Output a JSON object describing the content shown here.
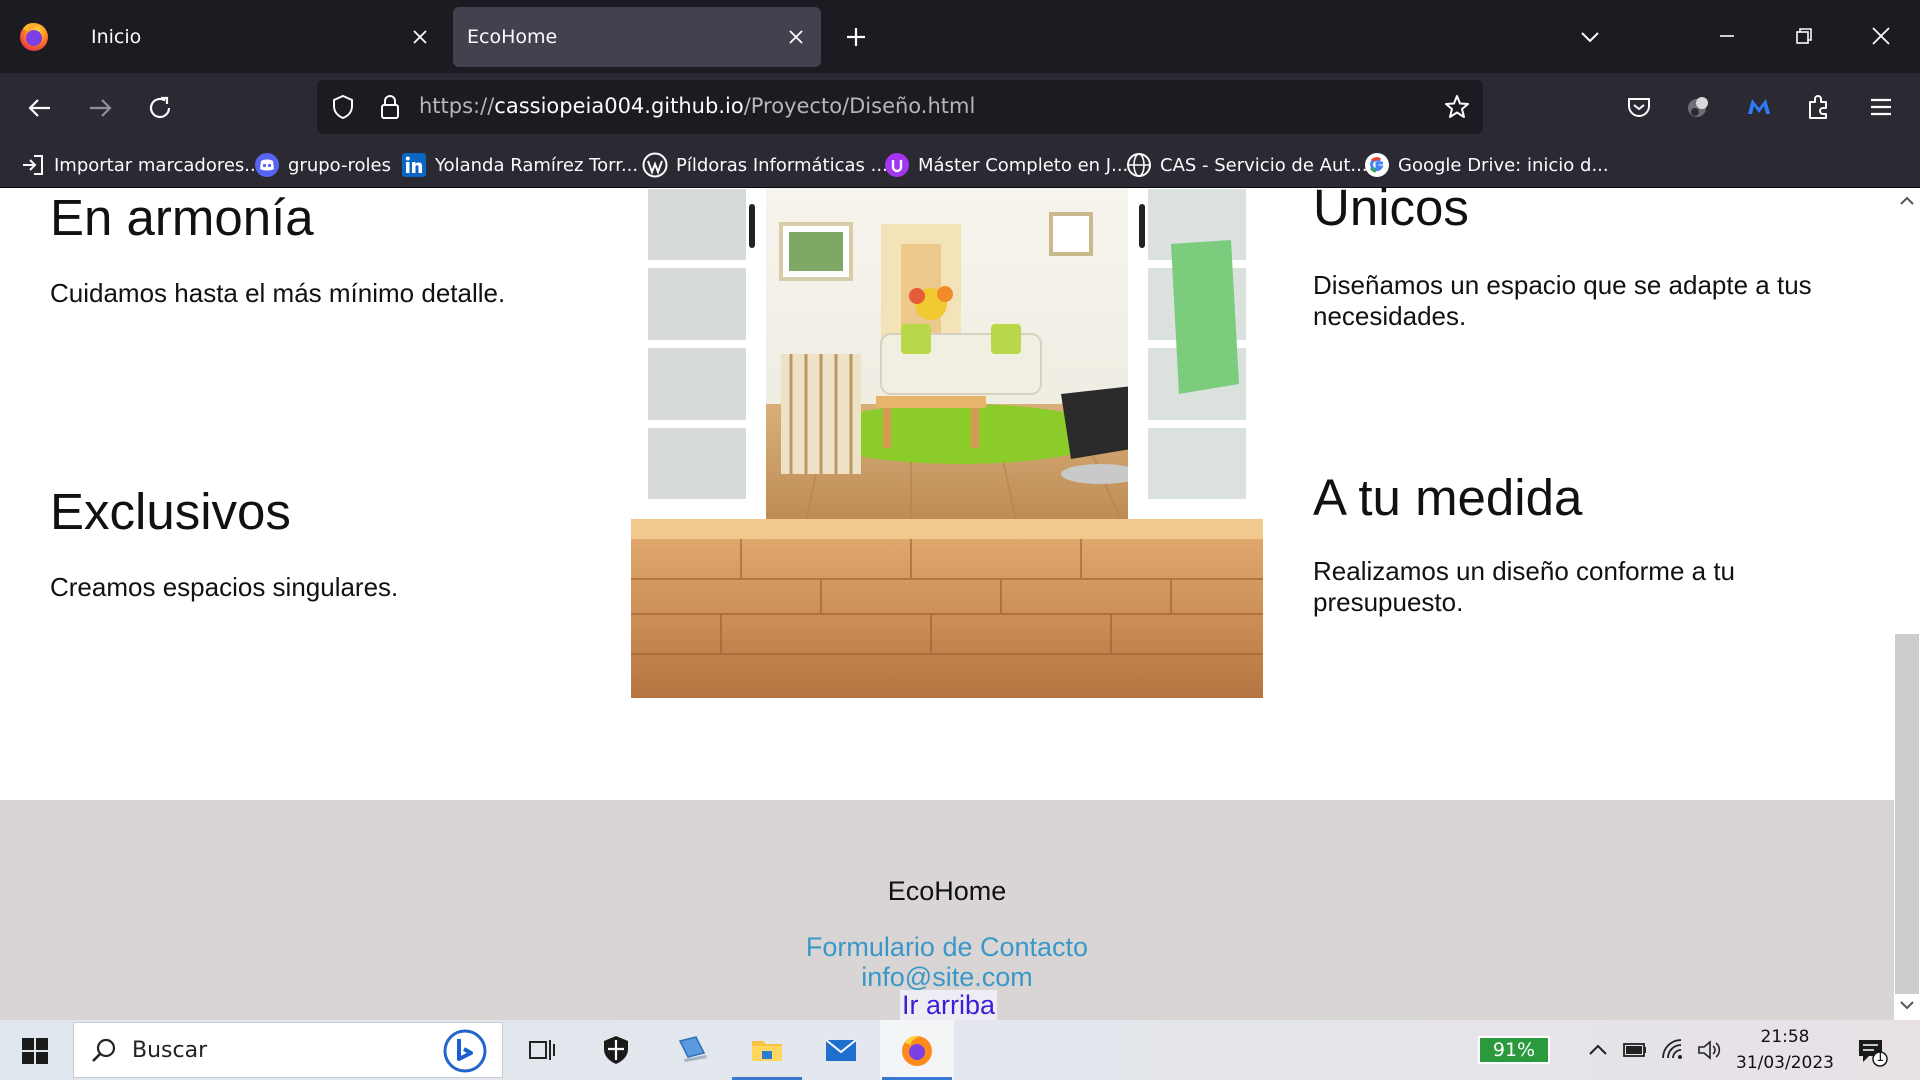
{
  "browser": {
    "tabs": [
      {
        "label": "Inicio",
        "active": false
      },
      {
        "label": "EcoHome",
        "active": true
      }
    ],
    "url": {
      "scheme": "https://",
      "host": "cassiopeia004.github.io",
      "path": "/Proyecto/Diseño.html"
    },
    "bookmarks": [
      {
        "label": "Importar marcadores...",
        "icon": "import-icon"
      },
      {
        "label": "grupo-roles",
        "icon": "discord-icon"
      },
      {
        "label": "Yolanda Ramírez Torr...",
        "icon": "linkedin-icon"
      },
      {
        "label": "Píldoras Informáticas ...",
        "icon": "wordpress-icon"
      },
      {
        "label": "Máster Completo en J...",
        "icon": "udemy-icon"
      },
      {
        "label": "CAS - Servicio de Aut...",
        "icon": "globe-icon"
      },
      {
        "label": "Google Drive: inicio d...",
        "icon": "google-icon"
      }
    ]
  },
  "page": {
    "features": [
      {
        "title": "En armonía",
        "text": "Cuidamos hasta el más mínimo detalle."
      },
      {
        "title": "Exclusivos",
        "text": "Creamos espacios singulares."
      },
      {
        "title": "Unicos",
        "text": "Diseñamos un espacio que se adapte a tus necesidades."
      },
      {
        "title": "A tu medida",
        "text": "Realizamos un diseño conforme a tu presupuesto."
      }
    ],
    "footer": {
      "brand": "EcoHome",
      "contact_link": "Formulario de Contacto",
      "email_link": "info@site.com",
      "top_link": "Ir arriba"
    }
  },
  "taskbar": {
    "search_placeholder": "Buscar",
    "battery": "91%",
    "time": "21:58",
    "date": "31/03/2023",
    "notifications": "1"
  },
  "colors": {
    "tabstrip": "#1c1b22",
    "toolbar": "#2b2a33",
    "footer_bg": "#d9d5d5",
    "link": "#3a98c8",
    "link_visited": "#3a1ed8",
    "battery": "#2b9a3f"
  }
}
